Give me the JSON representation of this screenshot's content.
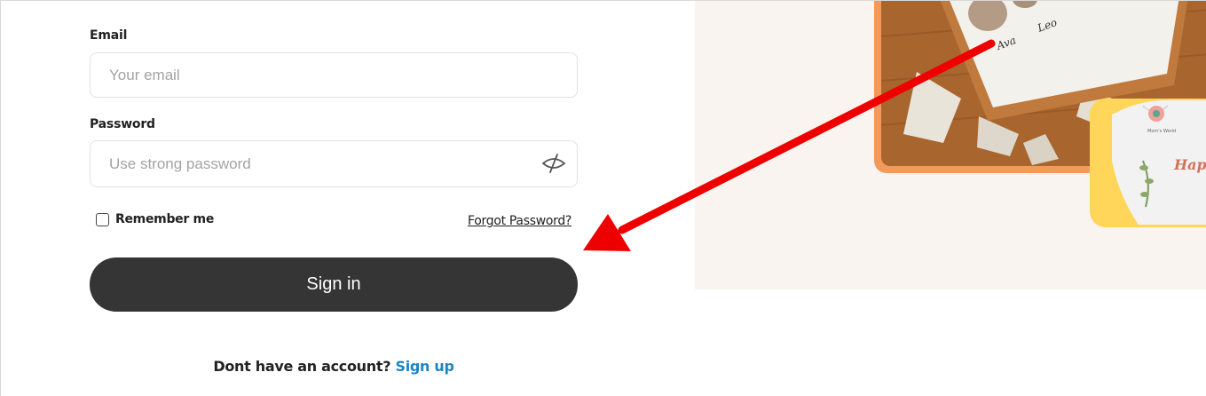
{
  "form": {
    "email_label": "Email",
    "email_placeholder": "Your email",
    "password_label": "Password",
    "password_placeholder": "Use strong password",
    "remember_label": "Remember me",
    "forgot_label": "Forgot Password?",
    "signin_label": "Sign in",
    "signup_prompt": "Dont have an account?",
    "signup_link": "Sign up"
  },
  "product_image": {
    "names_on_frame": [
      "Ava",
      "Leo"
    ],
    "shirt_text": "Happy Mot Da",
    "shirt_logo_text": "Mom's World"
  },
  "colors": {
    "button_bg": "#353535",
    "link": "#1a86c4",
    "panel_bg": "#f9f4ef",
    "frame_orange": "#f29a5c",
    "card_yellow": "#ffd65a",
    "arrow": "#ee0000"
  },
  "icons": {
    "password_toggle": "eye-slash-icon"
  }
}
